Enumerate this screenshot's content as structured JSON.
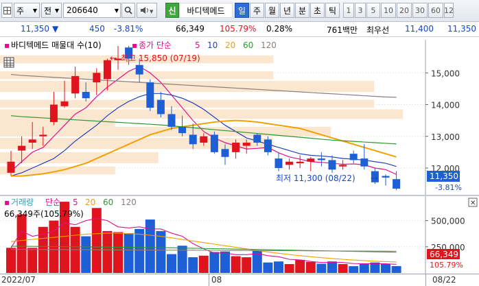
{
  "toolbar": {
    "menu_label": "주",
    "prev_label": "전",
    "stock_code": "206640",
    "stock_name": "바디텍메드",
    "badge_label": "신",
    "periods": [
      "일",
      "주",
      "월",
      "년",
      "분",
      "초",
      "틱"
    ],
    "selected_period": "일",
    "intervals": [
      "1",
      "3",
      "5",
      "10",
      "20",
      "30",
      "60",
      "12"
    ]
  },
  "quote": {
    "price": "11,350",
    "change": "450",
    "change_pct": "-3.81%",
    "volume": "66,349",
    "volume_ratio": "105.79%",
    "turnover": "0.28%",
    "amount": "761백만",
    "best_bid_label": "최우선",
    "ask": "11,400",
    "bid": "11,350"
  },
  "price_chart": {
    "legend": {
      "title": "바디텍메드 매물대 수(10)",
      "ma_label": "종가 단순",
      "ma_periods": [
        "5",
        "10",
        "20",
        "60",
        "120"
      ]
    },
    "high_annotation": "최고 15,850 (07/19)",
    "low_annotation": "최저 11,300 (08/22)",
    "current_price_tag": "11,350",
    "current_pct_tag": "-3.81%",
    "y_ticks": [
      "15,000",
      "14,000",
      "13,000",
      "12,000"
    ]
  },
  "volume_chart": {
    "legend": {
      "title": "거래량",
      "ma_label": "단순",
      "ma_periods": [
        "5",
        "20",
        "60",
        "120"
      ]
    },
    "readout": "66,349주(105.79%)",
    "current_volume_tag": "66,349",
    "current_pct_tag": "105.79%",
    "y_ticks": [
      "500,000",
      "250,000"
    ]
  },
  "x_axis": {
    "labels": [
      "2022/07",
      "08",
      "08/22"
    ]
  },
  "colors": {
    "up": "#e0141e",
    "down": "#1f5fd6",
    "ma5": "#e0108c",
    "ma10": "#1f3fc0",
    "ma20": "#f0a000",
    "ma60": "#2a9a2a",
    "ma120": "#8a7f7a",
    "volume_profile": "#fbe6d0"
  },
  "chart_data": [
    {
      "type": "candlestick",
      "title": "바디텍메드",
      "candles": [
        {
          "o": 11850,
          "h": 12550,
          "l": 11750,
          "c": 12200
        },
        {
          "o": 12550,
          "h": 13000,
          "l": 12150,
          "c": 12700
        },
        {
          "o": 12800,
          "h": 13450,
          "l": 12600,
          "c": 12900
        },
        {
          "o": 13000,
          "h": 13300,
          "l": 12700,
          "c": 13050
        },
        {
          "o": 13450,
          "h": 14400,
          "l": 13350,
          "c": 14000
        },
        {
          "o": 13950,
          "h": 14750,
          "l": 13900,
          "c": 14100
        },
        {
          "o": 14350,
          "h": 15200,
          "l": 14200,
          "c": 14900
        },
        {
          "o": 14400,
          "h": 14700,
          "l": 14100,
          "c": 14200
        },
        {
          "o": 14700,
          "h": 15150,
          "l": 14300,
          "c": 15000
        },
        {
          "o": 14800,
          "h": 15450,
          "l": 14450,
          "c": 15400
        },
        {
          "o": 15400,
          "h": 15850,
          "l": 15100,
          "c": 15450
        },
        {
          "o": 15800,
          "h": 15850,
          "l": 15250,
          "c": 15450
        },
        {
          "o": 15250,
          "h": 15450,
          "l": 14700,
          "c": 14950
        },
        {
          "o": 14700,
          "h": 14800,
          "l": 13800,
          "c": 13900
        },
        {
          "o": 14150,
          "h": 14400,
          "l": 13600,
          "c": 13700
        },
        {
          "o": 13700,
          "h": 13950,
          "l": 13200,
          "c": 13300
        },
        {
          "o": 13300,
          "h": 13650,
          "l": 13000,
          "c": 13100
        },
        {
          "o": 13050,
          "h": 13400,
          "l": 12600,
          "c": 12750
        },
        {
          "o": 12800,
          "h": 13100,
          "l": 12700,
          "c": 13000
        },
        {
          "o": 13050,
          "h": 13150,
          "l": 12450,
          "c": 12500
        },
        {
          "o": 12600,
          "h": 12750,
          "l": 12100,
          "c": 12350
        },
        {
          "o": 12500,
          "h": 12900,
          "l": 12300,
          "c": 12800
        },
        {
          "o": 12700,
          "h": 12900,
          "l": 12450,
          "c": 12800
        },
        {
          "o": 13050,
          "h": 13100,
          "l": 12700,
          "c": 12800
        },
        {
          "o": 12900,
          "h": 13000,
          "l": 12400,
          "c": 12500
        },
        {
          "o": 12300,
          "h": 12500,
          "l": 11900,
          "c": 12000
        },
        {
          "o": 12100,
          "h": 12300,
          "l": 11950,
          "c": 12200
        },
        {
          "o": 12150,
          "h": 12400,
          "l": 12000,
          "c": 12200
        },
        {
          "o": 12200,
          "h": 12350,
          "l": 11900,
          "c": 12300
        },
        {
          "o": 12300,
          "h": 12500,
          "l": 12050,
          "c": 12250
        },
        {
          "o": 12250,
          "h": 12400,
          "l": 11850,
          "c": 11950
        },
        {
          "o": 12050,
          "h": 12250,
          "l": 11950,
          "c": 12100
        },
        {
          "o": 12450,
          "h": 12550,
          "l": 12150,
          "c": 12250
        },
        {
          "o": 12300,
          "h": 12750,
          "l": 11950,
          "c": 12050
        },
        {
          "o": 11900,
          "h": 12000,
          "l": 11500,
          "c": 11550
        },
        {
          "o": 11750,
          "h": 11800,
          "l": 11450,
          "c": 11700
        },
        {
          "o": 11650,
          "h": 11900,
          "l": 11300,
          "c": 11350
        }
      ],
      "ma_series": [
        {
          "name": "5",
          "values": [
            11900,
            12200,
            12500,
            12650,
            13000,
            13350,
            13700,
            13900,
            14250,
            14550,
            14800,
            15050,
            15200,
            15000,
            14700,
            14300,
            13900,
            13500,
            13150,
            12950,
            12800,
            12700,
            12600,
            12620,
            12650,
            12480,
            12350,
            12280,
            12200,
            12180,
            12150,
            12120,
            12130,
            12100,
            12000,
            11950,
            11800
          ]
        },
        {
          "name": "10",
          "values": [
            11750,
            11850,
            12000,
            12150,
            12300,
            12550,
            12850,
            13100,
            13350,
            13650,
            13900,
            14100,
            14250,
            14350,
            14350,
            14300,
            14200,
            14050,
            13850,
            13600,
            13350,
            13150,
            12950,
            12850,
            12750,
            12650,
            12550,
            12450,
            12400,
            12380,
            12350,
            12300,
            12280,
            12250,
            12200,
            12150,
            12050
          ]
        },
        {
          "name": "20",
          "values": [
            11750,
            11750,
            11780,
            11820,
            11880,
            11950,
            12050,
            12150,
            12300,
            12450,
            12600,
            12750,
            12900,
            13050,
            13150,
            13250,
            13300,
            13350,
            13400,
            13450,
            13480,
            13500,
            13480,
            13450,
            13400,
            13350,
            13300,
            13250,
            13150,
            13050,
            12950,
            12850,
            12750,
            12650,
            12550,
            12450,
            12350
          ]
        },
        {
          "name": "60",
          "values": [
            13650,
            13620,
            13600,
            13580,
            13560,
            13540,
            13520,
            13500,
            13480,
            13460,
            13440,
            13420,
            13400,
            13380,
            13360,
            13330,
            13300,
            13270,
            13240,
            13210,
            13180,
            13150,
            13120,
            13090,
            13060,
            13030,
            13000,
            12970,
            12940,
            12910,
            12880,
            12860,
            12840,
            12820,
            12800,
            12780,
            12760
          ]
        },
        {
          "name": "120",
          "values": [
            14950,
            14920,
            14900,
            14880,
            14860,
            14840,
            14820,
            14800,
            14780,
            14760,
            14740,
            14720,
            14700,
            14680,
            14660,
            14640,
            14620,
            14600,
            14580,
            14560,
            14540,
            14520,
            14500,
            14480,
            14460,
            14440,
            14420,
            14400,
            14380,
            14360,
            14340,
            14320,
            14300,
            14280,
            14260,
            14240,
            14230
          ]
        }
      ],
      "volume_profile": [
        {
          "lo": 15300,
          "hi": 15550,
          "vol": 19
        },
        {
          "lo": 14800,
          "hi": 15050,
          "vol": 19
        },
        {
          "lo": 14400,
          "hi": 14750,
          "vol": 26
        },
        {
          "lo": 13900,
          "hi": 14150,
          "vol": 26
        },
        {
          "lo": 13550,
          "hi": 13850,
          "vol": 28
        },
        {
          "lo": 13300,
          "hi": 13550,
          "vol": 8
        },
        {
          "lo": 13000,
          "hi": 13300,
          "vol": 23
        },
        {
          "lo": 12600,
          "hi": 12950,
          "vol": 19
        },
        {
          "lo": 12150,
          "hi": 12500,
          "vol": 11
        },
        {
          "lo": 11800,
          "hi": 12050,
          "vol": 8
        }
      ],
      "ylim": [
        11200,
        16000
      ]
    },
    {
      "type": "bar",
      "title": "거래량",
      "values": [
        240000,
        560000,
        240000,
        440000,
        500000,
        680000,
        440000,
        350000,
        620000,
        400000,
        390000,
        380000,
        420000,
        510000,
        400000,
        180000,
        260000,
        150000,
        165000,
        200000,
        205000,
        160000,
        150000,
        210000,
        100000,
        110000,
        85000,
        125000,
        105000,
        88000,
        110000,
        85000,
        65000,
        90000,
        100000,
        85000,
        66000
      ],
      "ma_series": [
        {
          "name": "5",
          "values": [
            240000,
            400000,
            350000,
            370000,
            400000,
            480000,
            460000,
            500000,
            520000,
            500000,
            440000,
            430000,
            440000,
            420000,
            420000,
            380000,
            350000,
            280000,
            230000,
            190000,
            190000,
            175000,
            175000,
            185000,
            165000,
            155000,
            130000,
            125000,
            110000,
            100000,
            100000,
            100000,
            90000,
            88000,
            90000,
            88000,
            82000
          ]
        },
        {
          "name": "20",
          "values": [
            300000,
            310000,
            320000,
            330000,
            340000,
            350000,
            360000,
            370000,
            375000,
            380000,
            380000,
            375000,
            370000,
            360000,
            350000,
            335000,
            320000,
            305000,
            290000,
            275000,
            260000,
            245000,
            230000,
            215000,
            200000,
            188000,
            176000,
            165000,
            155000,
            146000,
            138000,
            130000,
            124000,
            118000,
            112000,
            108000,
            104000
          ]
        },
        {
          "name": "60",
          "values": [
            255000,
            255000,
            254000,
            253000,
            252000,
            251000,
            250000,
            249000,
            248000,
            247000,
            246000,
            245000,
            244000,
            243000,
            242000,
            240000,
            238000,
            236000,
            234000,
            232000,
            230000,
            228000,
            226000,
            224000,
            222000,
            220000,
            218000,
            216000,
            214000,
            212000,
            210000,
            208000,
            206000,
            204000,
            202000,
            200000,
            198000
          ]
        },
        {
          "name": "120",
          "values": [
            225000,
            225000,
            224000,
            224000,
            223000,
            223000,
            222000,
            222000,
            221000,
            221000,
            220000,
            220000,
            219000,
            219000,
            218000,
            218000,
            217000,
            217000,
            216000,
            216000,
            215000,
            215000,
            214000,
            214000,
            213000,
            213000,
            212000,
            212000,
            211000,
            211000,
            210000,
            210000,
            209000,
            209000,
            208000,
            208000,
            207000
          ]
        }
      ],
      "ylim": [
        0,
        720000
      ]
    }
  ]
}
